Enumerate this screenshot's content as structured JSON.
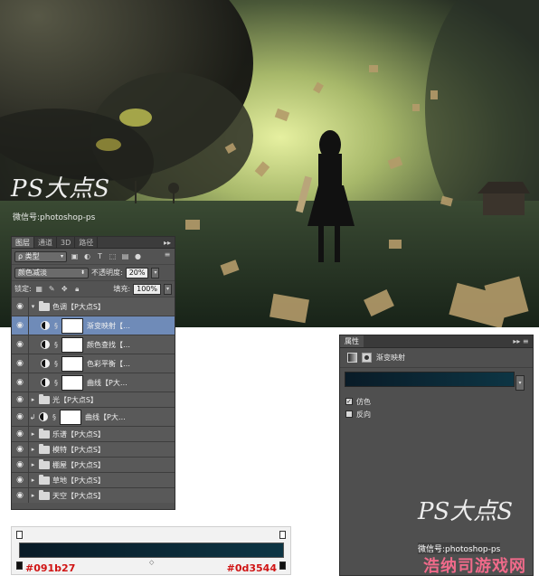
{
  "watermark": {
    "logo_text": "PS大点S",
    "weixin_line": "微信号:photoshop-ps"
  },
  "layers_panel": {
    "tabs": [
      "图层",
      "通道",
      "3D",
      "路径"
    ],
    "menu_glyph": "▸▸ ≡",
    "filter_label": "ρ 类型",
    "blend_mode": "颜色减淡",
    "opacity_label": "不透明度:",
    "opacity_value": "20%",
    "lock_label": "锁定:",
    "fill_label": "填充:",
    "fill_value": "100%",
    "layers": [
      {
        "name": "色调【P大点S】",
        "type": "group",
        "expanded": true
      },
      {
        "name": "渐变映射【…",
        "type": "adjustment",
        "selected": true
      },
      {
        "name": "颜色查找【…",
        "type": "adjustment"
      },
      {
        "name": "色彩平衡【…",
        "type": "adjustment"
      },
      {
        "name": "曲线【P大…",
        "type": "adjustment"
      },
      {
        "name": "光【P大点S】",
        "type": "group"
      },
      {
        "name": "曲线【P大…",
        "type": "adjustment",
        "clipped": true
      },
      {
        "name": "乐谱【P大点S】",
        "type": "group"
      },
      {
        "name": "模特【P大点S】",
        "type": "group"
      },
      {
        "name": "棚屋【P大点S】",
        "type": "group"
      },
      {
        "name": "草地【P大点S】",
        "type": "group"
      },
      {
        "name": "天空【P大点S】",
        "type": "group"
      }
    ]
  },
  "properties_panel": {
    "tab": "属性",
    "title": "渐变映射",
    "options": [
      {
        "label": "仿色",
        "checked": true
      },
      {
        "label": "反向",
        "checked": false
      }
    ],
    "gradient_colors": [
      "#091b27",
      "#0d3544"
    ]
  },
  "gradient_bar": {
    "left_hex": "#091b27",
    "right_hex": "#0d3544",
    "midpoint_glyph": "◇"
  },
  "site_watermark": "浩纳司游戏网",
  "colors": {
    "panel_bg": "#535353",
    "selected_row": "#6f8bb8",
    "hex_text": "#d01414"
  }
}
